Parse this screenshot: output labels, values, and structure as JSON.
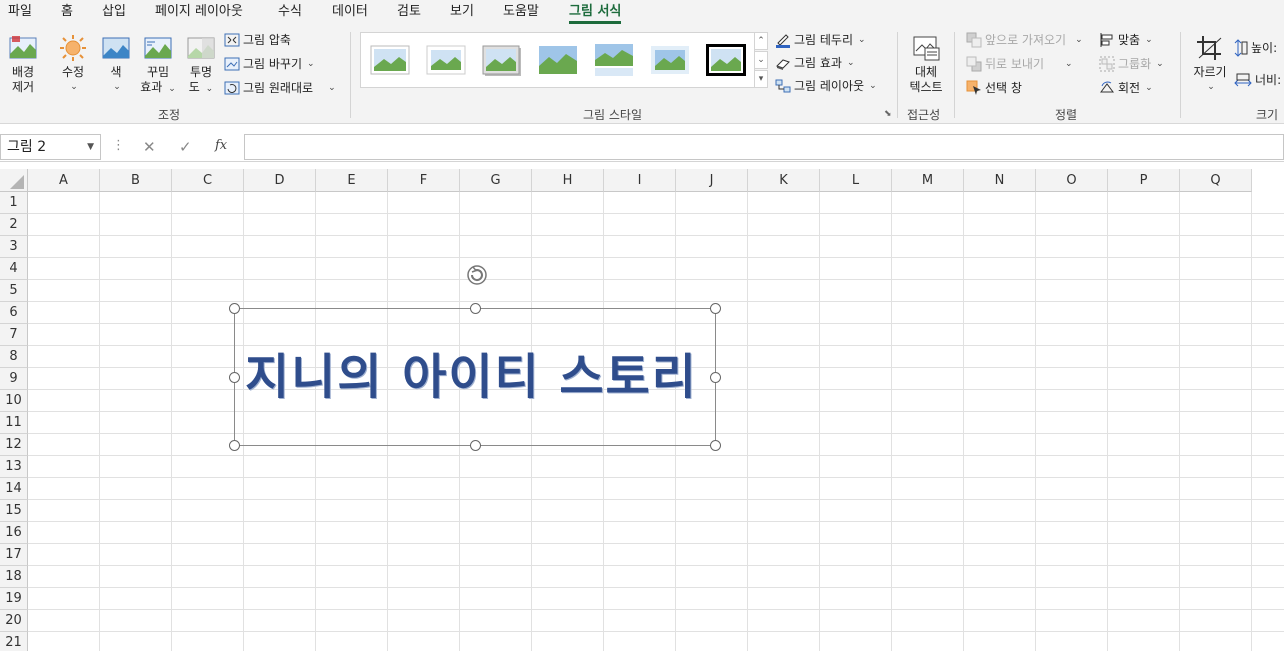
{
  "menu": {
    "tabs": [
      "파일",
      "홈",
      "삽입",
      "페이지 레이아웃",
      "수식",
      "데이터",
      "검토",
      "보기",
      "도움말",
      "그림 서식"
    ],
    "active_tab": "그림 서식"
  },
  "ribbon": {
    "adjust": {
      "remove_bg": [
        "배경",
        "제거"
      ],
      "corrections": "수정",
      "color": "색",
      "artistic": [
        "꾸밈",
        "효과"
      ],
      "transparency": [
        "투명",
        "도"
      ],
      "compress": "그림 압축",
      "change": "그림 바꾸기",
      "reset": "그림 원래대로",
      "label": "조정"
    },
    "styles": {
      "border": "그림 테두리",
      "effects": "그림 효과",
      "layout": "그림 레이아웃",
      "label": "그림 스타일"
    },
    "accessibility": {
      "alt_text": [
        "대체",
        "텍스트"
      ],
      "label": "접근성"
    },
    "arrange": {
      "bring_forward": "앞으로 가져오기",
      "send_backward": "뒤로 보내기",
      "selection_pane": "선택 창",
      "align": "맞춤",
      "group": "그룹화",
      "rotate": "회전",
      "label": "정렬"
    },
    "size": {
      "crop": "자르기",
      "height": "높이:",
      "width": "너비:",
      "label": "크기"
    }
  },
  "formula_bar": {
    "name_box": "그림 2",
    "fx": "fx",
    "value": ""
  },
  "sheet": {
    "columns": [
      "A",
      "B",
      "C",
      "D",
      "E",
      "F",
      "G",
      "H",
      "I",
      "J",
      "K",
      "L",
      "M",
      "N",
      "O",
      "P",
      "Q"
    ],
    "rows": [
      "1",
      "2",
      "3",
      "4",
      "5",
      "6",
      "7",
      "8",
      "9",
      "10",
      "11",
      "12",
      "13",
      "14",
      "15",
      "16",
      "17",
      "18",
      "19",
      "20",
      "21"
    ]
  },
  "picture": {
    "text": "지니의 아이티 스토리",
    "text_color": "#2f4d8c"
  },
  "colors": {
    "accent": "#1d6b3c",
    "ribbon_bg": "#f3f3f3"
  }
}
